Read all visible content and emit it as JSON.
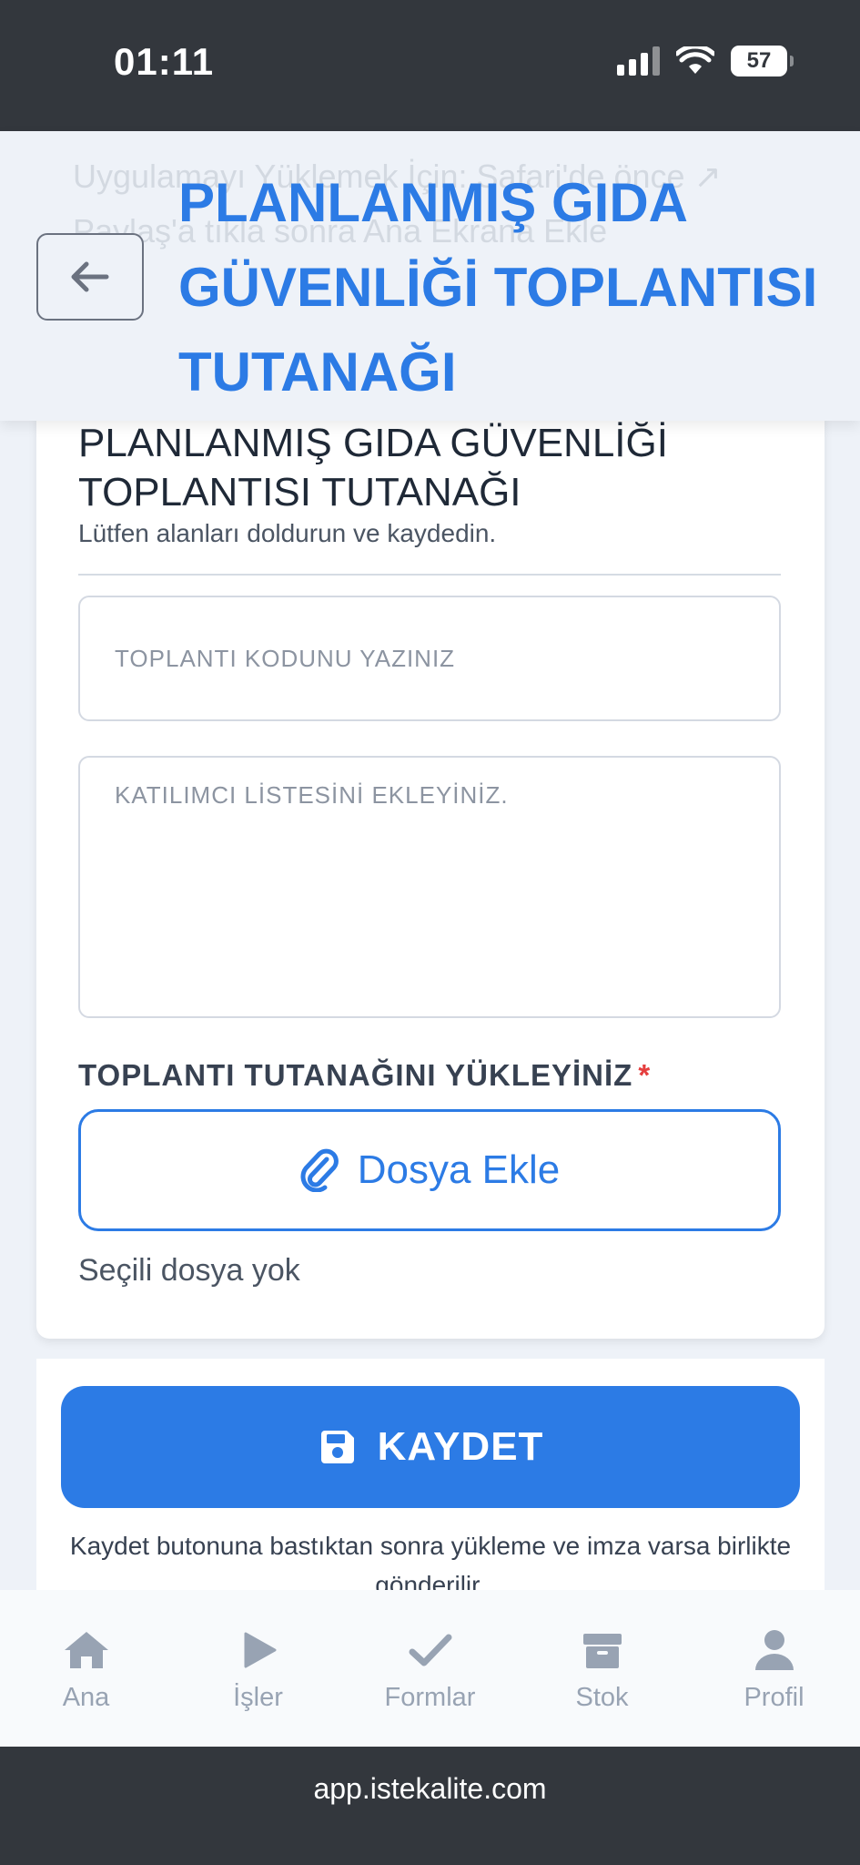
{
  "status_bar": {
    "time": "01:11",
    "battery": "57"
  },
  "header": {
    "ghost_text": "Uygulamayı Yüklemek İçin: Safari'de önce ↗ Paylaş'a tıkla sonra Ana Ekrana Ekle",
    "title": "PLANLANMIŞ GIDA GÜVENLİĞİ TOPLANTISI TUTANAĞI",
    "back_icon": "arrow-left-icon"
  },
  "form": {
    "title": "PLANLANMIŞ GIDA GÜVENLİĞİ TOPLANTISI TUTANAĞI",
    "subtitle": "Lütfen alanları doldurun ve kaydedin.",
    "code_field": {
      "placeholder": "TOPLANTI KODUNU YAZINIZ",
      "value": ""
    },
    "participants_field": {
      "placeholder": "KATILIMCI LİSTESİNİ EKLEYİNİZ.",
      "value": ""
    },
    "upload_label": "TOPLANTI TUTANAĞINI YÜKLEYİNİZ",
    "required_mark": "*",
    "file_button_label": "Dosya Ekle",
    "file_status": "Seçili dosya yok"
  },
  "save": {
    "label": "KAYDET",
    "note": "Kaydet butonuna bastıktan sonra yükleme ve imza varsa birlikte gönderilir."
  },
  "bottom_nav": {
    "items": [
      {
        "label": "Ana",
        "icon": "home-icon"
      },
      {
        "label": "İşler",
        "icon": "play-icon"
      },
      {
        "label": "Formlar",
        "icon": "check-icon"
      },
      {
        "label": "Stok",
        "icon": "box-icon"
      },
      {
        "label": "Profil",
        "icon": "user-icon"
      }
    ]
  },
  "url_bar": {
    "url": "app.istekalite.com"
  },
  "colors": {
    "accent": "#2c7be5",
    "required": "#e53e3e",
    "chrome": "#33373d",
    "nav_icon": "#98a3b3"
  }
}
